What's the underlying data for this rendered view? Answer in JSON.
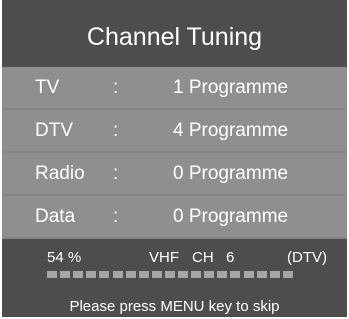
{
  "title": "Channel Tuning",
  "rows": [
    {
      "label": "TV",
      "separator": ":",
      "value": "1 Programme"
    },
    {
      "label": "DTV",
      "separator": ":",
      "value": "4 Programme"
    },
    {
      "label": "Radio",
      "separator": ":",
      "value": "0 Programme"
    },
    {
      "label": "Data",
      "separator": ":",
      "value": "0 Programme"
    }
  ],
  "status": {
    "percent": "54 %",
    "band": "VHF",
    "channel_label": "CH",
    "channel_number": "6",
    "mode": "(DTV)"
  },
  "progress": {
    "segments_total": 19,
    "segments_filled": 19
  },
  "hint": "Please press MENU key to skip",
  "colors": {
    "panel": "#4d4d4d",
    "row": "#8f8f8f",
    "segment": "#a6a6a6",
    "text": "#ffffff"
  }
}
